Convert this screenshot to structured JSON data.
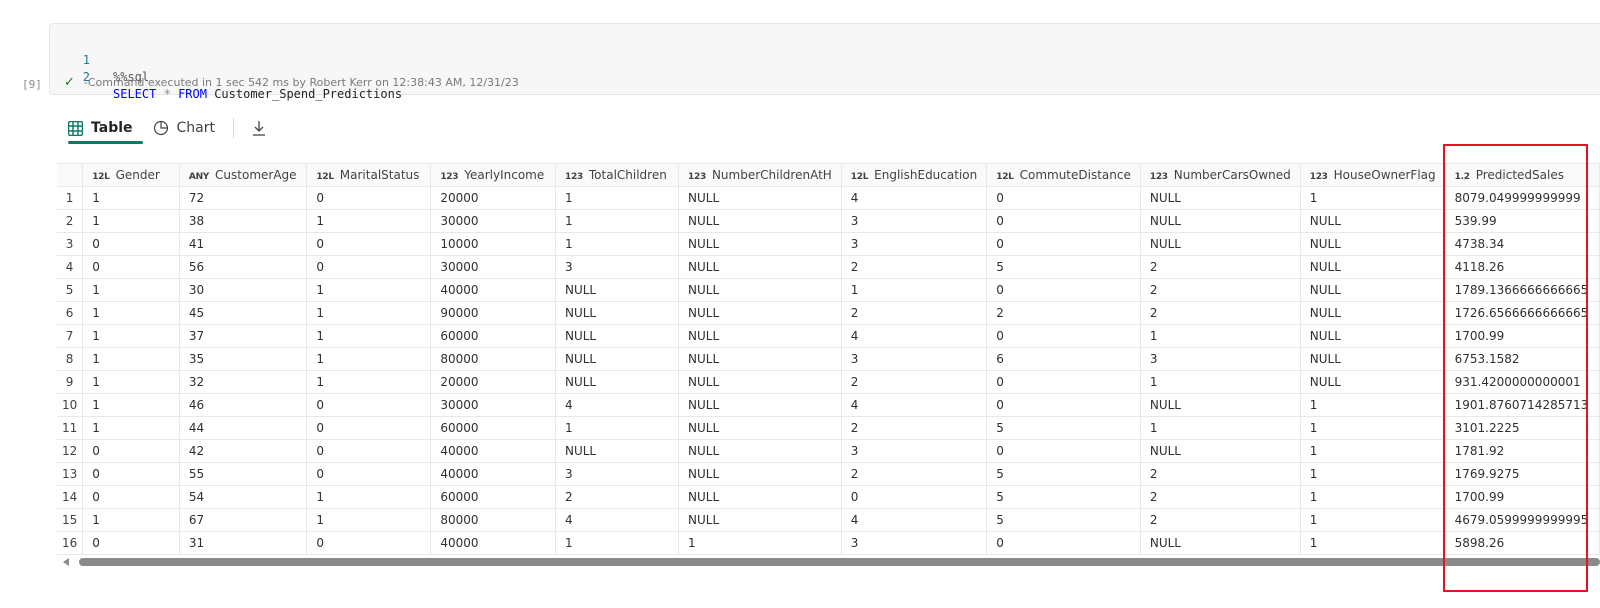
{
  "cell": {
    "execution_label": "[9]",
    "code_lines": [
      {
        "number": "1",
        "magic": "%%sql"
      },
      {
        "number": "2",
        "keyword1": "SELECT",
        "operator": "*",
        "keyword2": "FROM",
        "table": "Customer_Spend_Predictions"
      }
    ],
    "status_text": "-Command executed in 1 sec 542 ms by Robert Kerr on 12:38:43 AM, 12/31/23"
  },
  "tabs": {
    "table_label": "Table",
    "chart_label": "Chart"
  },
  "colors": {
    "accent": "#117865",
    "highlight": "#e81123",
    "success": "#107c10"
  },
  "table": {
    "columns": [
      {
        "type": "12L",
        "name": "Gender"
      },
      {
        "type": "ANY",
        "name": "CustomerAge"
      },
      {
        "type": "12L",
        "name": "MaritalStatus"
      },
      {
        "type": "123",
        "name": "YearlyIncome"
      },
      {
        "type": "123",
        "name": "TotalChildren"
      },
      {
        "type": "123",
        "name": "NumberChildrenAtH"
      },
      {
        "type": "12L",
        "name": "EnglishEducation"
      },
      {
        "type": "12L",
        "name": "CommuteDistance"
      },
      {
        "type": "123",
        "name": "NumberCarsOwned"
      },
      {
        "type": "123",
        "name": "HouseOwnerFlag"
      },
      {
        "type": "1.2",
        "name": "PredictedSales"
      }
    ],
    "rows": [
      [
        "1",
        "1",
        "72",
        "0",
        "20000",
        "1",
        "NULL",
        "4",
        "0",
        "NULL",
        "1",
        "8079.049999999999"
      ],
      [
        "2",
        "1",
        "38",
        "1",
        "30000",
        "1",
        "NULL",
        "3",
        "0",
        "NULL",
        "NULL",
        "539.99"
      ],
      [
        "3",
        "0",
        "41",
        "0",
        "10000",
        "1",
        "NULL",
        "3",
        "0",
        "NULL",
        "NULL",
        "4738.34"
      ],
      [
        "4",
        "0",
        "56",
        "0",
        "30000",
        "3",
        "NULL",
        "2",
        "5",
        "2",
        "NULL",
        "4118.26"
      ],
      [
        "5",
        "1",
        "30",
        "1",
        "40000",
        "NULL",
        "NULL",
        "1",
        "0",
        "2",
        "NULL",
        "1789.1366666666665"
      ],
      [
        "6",
        "1",
        "45",
        "1",
        "90000",
        "NULL",
        "NULL",
        "2",
        "2",
        "2",
        "NULL",
        "1726.6566666666665"
      ],
      [
        "7",
        "1",
        "37",
        "1",
        "60000",
        "NULL",
        "NULL",
        "4",
        "0",
        "1",
        "NULL",
        "1700.99"
      ],
      [
        "8",
        "1",
        "35",
        "1",
        "80000",
        "NULL",
        "NULL",
        "3",
        "6",
        "3",
        "NULL",
        "6753.1582"
      ],
      [
        "9",
        "1",
        "32",
        "1",
        "20000",
        "NULL",
        "NULL",
        "2",
        "0",
        "1",
        "NULL",
        "931.4200000000001"
      ],
      [
        "10",
        "1",
        "46",
        "0",
        "30000",
        "4",
        "NULL",
        "4",
        "0",
        "NULL",
        "1",
        "1901.8760714285713"
      ],
      [
        "11",
        "1",
        "44",
        "0",
        "60000",
        "1",
        "NULL",
        "2",
        "5",
        "1",
        "1",
        "3101.2225"
      ],
      [
        "12",
        "0",
        "42",
        "0",
        "40000",
        "NULL",
        "NULL",
        "3",
        "0",
        "NULL",
        "1",
        "1781.92"
      ],
      [
        "13",
        "0",
        "55",
        "0",
        "40000",
        "3",
        "NULL",
        "2",
        "5",
        "2",
        "1",
        "1769.9275"
      ],
      [
        "14",
        "0",
        "54",
        "1",
        "60000",
        "2",
        "NULL",
        "0",
        "5",
        "2",
        "1",
        "1700.99"
      ],
      [
        "15",
        "1",
        "67",
        "1",
        "80000",
        "4",
        "NULL",
        "4",
        "5",
        "2",
        "1",
        "4679.0599999999995"
      ],
      [
        "16",
        "0",
        "31",
        "0",
        "40000",
        "1",
        "1",
        "3",
        "0",
        "NULL",
        "1",
        "5898.26"
      ]
    ]
  }
}
